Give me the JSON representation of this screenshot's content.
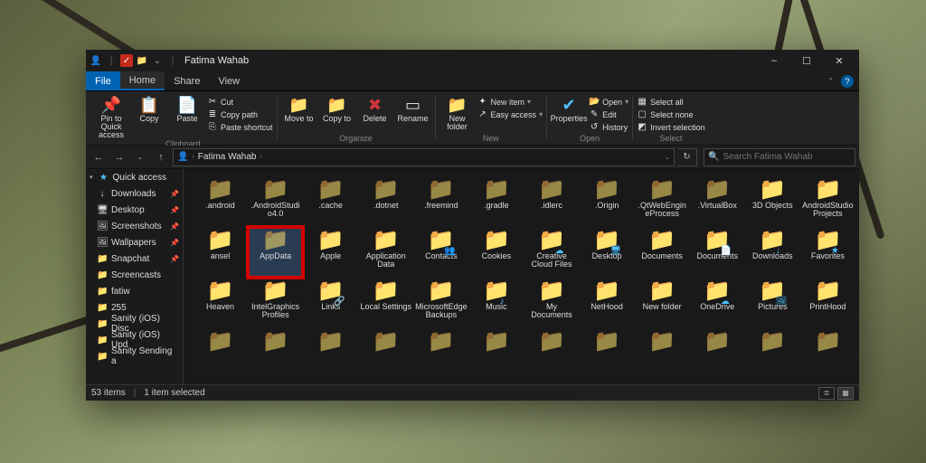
{
  "title": "Fatima Wahab",
  "window_buttons": {
    "min": "–",
    "max": "☐",
    "close": "✕"
  },
  "menu": {
    "file": "File",
    "tabs": [
      "Home",
      "Share",
      "View"
    ]
  },
  "ribbon": {
    "clipboard": {
      "pin": "Pin to Quick\naccess",
      "copy": "Copy",
      "paste": "Paste",
      "cut": "Cut",
      "copy_path": "Copy path",
      "paste_short": "Paste shortcut",
      "label": "Clipboard"
    },
    "organize": {
      "move": "Move\nto",
      "copy": "Copy\nto",
      "delete": "Delete",
      "rename": "Rename",
      "label": "Organize"
    },
    "new": {
      "folder": "New\nfolder",
      "item": "New item",
      "easy": "Easy access",
      "label": "New"
    },
    "open": {
      "properties": "Properties",
      "open": "Open",
      "edit": "Edit",
      "history": "History",
      "label": "Open"
    },
    "select": {
      "all": "Select all",
      "none": "Select none",
      "invert": "Invert selection",
      "label": "Select"
    }
  },
  "nav": {
    "back": "←",
    "fwd": "→",
    "up": "↑",
    "refresh": "↻"
  },
  "address": {
    "user": "Fatima Wahab"
  },
  "search": {
    "placeholder": "Search Fatima Wahab"
  },
  "sidebar": {
    "quick": "Quick access",
    "items": [
      {
        "icon": "↓",
        "label": "Downloads",
        "pin": true
      },
      {
        "icon": "🖥",
        "label": "Desktop",
        "pin": true
      },
      {
        "icon": "🖼",
        "label": "Screenshots",
        "pin": true
      },
      {
        "icon": "🖼",
        "label": "Wallpapers",
        "pin": true
      },
      {
        "icon": "📁",
        "label": "Snapchat",
        "pin": true
      },
      {
        "icon": "📁",
        "label": "Screencasts",
        "pin": false
      },
      {
        "icon": "📁",
        "label": "fatiw",
        "pin": false
      },
      {
        "icon": "📁",
        "label": "255",
        "pin": false
      },
      {
        "icon": "📁",
        "label": "Sanity (iOS) Disc",
        "pin": false
      },
      {
        "icon": "📁",
        "label": "Sanity (iOS) Upd",
        "pin": false
      },
      {
        "icon": "📁",
        "label": "Sanity Sending a",
        "pin": false
      }
    ]
  },
  "folders": [
    [
      {
        "n": ".android",
        "g": true
      },
      {
        "n": ".AndroidStudio4.0",
        "g": true
      },
      {
        "n": ".cache",
        "g": true
      },
      {
        "n": ".dotnet",
        "g": true
      },
      {
        "n": ".freemind",
        "g": true
      },
      {
        "n": ".gradle",
        "g": true
      },
      {
        "n": ".idlerc",
        "g": true
      },
      {
        "n": ".Origin",
        "g": true
      },
      {
        "n": ".QtWebEngineProcess",
        "g": true
      },
      {
        "n": ".VirtualBox",
        "g": true
      },
      {
        "n": "3D Objects"
      },
      {
        "n": "AndroidStudioProjects"
      }
    ],
    [
      {
        "n": "ansel"
      },
      {
        "n": "AppData",
        "g": true,
        "hl": true,
        "sel": true
      },
      {
        "n": "Apple"
      },
      {
        "n": "Application Data",
        "sc": true
      },
      {
        "n": "Contacts",
        "ov": "👥"
      },
      {
        "n": "Cookies",
        "sc": true
      },
      {
        "n": "Creative Cloud Files",
        "ov": "☁"
      },
      {
        "n": "Desktop",
        "ov": "🖥"
      },
      {
        "n": "Documents",
        "sc": true
      },
      {
        "n": "Documents",
        "ov": "📄"
      },
      {
        "n": "Downloads",
        "ov": "↓"
      },
      {
        "n": "Favorites",
        "ov": "★"
      }
    ],
    [
      {
        "n": "Heaven"
      },
      {
        "n": "IntelGraphicsProfiles"
      },
      {
        "n": "Links",
        "ov": "🔗"
      },
      {
        "n": "Local Settings",
        "sc": true
      },
      {
        "n": "MicrosoftEdgeBackups"
      },
      {
        "n": "Music",
        "ov": "♪"
      },
      {
        "n": "My Documents",
        "sc": true
      },
      {
        "n": "NetHood",
        "sc": true
      },
      {
        "n": "New folder"
      },
      {
        "n": "OneDrive",
        "ov": "☁"
      },
      {
        "n": "Pictures",
        "ov": "🖼"
      },
      {
        "n": "PrintHood",
        "sc": true
      }
    ],
    [
      {
        "n": ""
      },
      {
        "n": ""
      },
      {
        "n": ""
      },
      {
        "n": ""
      },
      {
        "n": ""
      },
      {
        "n": ""
      },
      {
        "n": ""
      },
      {
        "n": ""
      },
      {
        "n": ""
      },
      {
        "n": ""
      },
      {
        "n": ""
      },
      {
        "n": ""
      }
    ]
  ],
  "status": {
    "count": "53 items",
    "sel": "1 item selected"
  }
}
